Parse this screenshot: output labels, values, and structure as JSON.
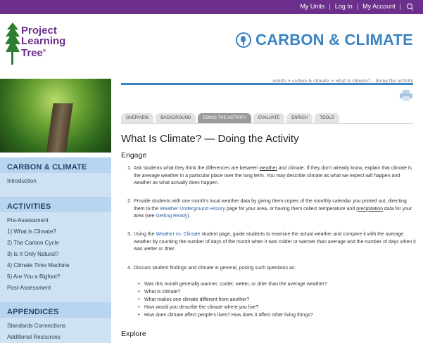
{
  "topnav": {
    "my_units": "My Units",
    "login": "Log In",
    "my_account": "My Account",
    "sep": "|"
  },
  "logo": {
    "line1": "Project",
    "line2": "Learning",
    "line3": "Tree",
    "reg": "®"
  },
  "site_title": "CARBON & CLIMATE",
  "breadcrumb": "eunits > carbon & climate > what is climate? -- doing the activity",
  "tabs": [
    {
      "label": "OVERVIEW"
    },
    {
      "label": "BACKGROUND"
    },
    {
      "label": "DOING THE ACTIVITY"
    },
    {
      "label": "EVALUATE"
    },
    {
      "label": "ENRICH"
    },
    {
      "label": "TOOLS"
    }
  ],
  "page_title": "What Is Climate? — Doing the Activity",
  "sidebar": {
    "section1": {
      "heading": "CARBON & CLIMATE",
      "items": [
        "Introduction"
      ]
    },
    "section2": {
      "heading": "ACTIVITIES",
      "items": [
        "Pre-Assessment",
        "1) What is Climate?",
        "2) The Carbon Cycle",
        "3) Is It Only Natural?",
        "4) Climate Time Machine",
        "5) Are You a Bigfoot?",
        "Post-Assessment"
      ]
    },
    "section3": {
      "heading": "APPENDICES",
      "items": [
        "Standards Connections",
        "Additional Resources"
      ]
    }
  },
  "engage": {
    "heading": "Engage",
    "step1": {
      "num": "1.",
      "pre": "Ask students what they think the differences are between ",
      "link": "weather",
      "post": " and climate. If they don't already know, explain that climate is the average weather in a particular place over the long term. You may describe climate as what we expect will happen and weather as what actually does happen."
    },
    "step2": {
      "num": "2.",
      "pre": "Provide students with one month's local weather data by giving them copies of the monthly calendar you printed out, directing them to the ",
      "link1": "Weather Underground History",
      "mid": " page for your area, or having them collect temperature and ",
      "link2": "precipitation",
      "mid2": " data for your area (see ",
      "link3": "Getting Ready",
      "post": ")."
    },
    "step3": {
      "num": "3.",
      "pre": "Using the ",
      "link": "Weather vs. Climate",
      "post": " student page, guide students to examine the actual weather and compare it with the average weather by counting the number of days of the month when it was colder or warmer than average and the number of days when it was wetter or drier."
    },
    "step4": {
      "num": "4.",
      "text": "Discuss student findings and climate in general, posing such questions as:"
    },
    "bullets": [
      "Was this month generally warmer, cooler, wetter, or drier than the average weather?",
      "What is climate?",
      "What makes one climate different from another?",
      "How would you describe the climate where you live?",
      "How does climate affect people's lives? How does it affect other living things?"
    ]
  },
  "explore": {
    "heading": "Explore"
  },
  "colors": {
    "purple": "#6c2f8c",
    "blue": "#3b84c4",
    "sidebar": "#cfe2f3"
  }
}
